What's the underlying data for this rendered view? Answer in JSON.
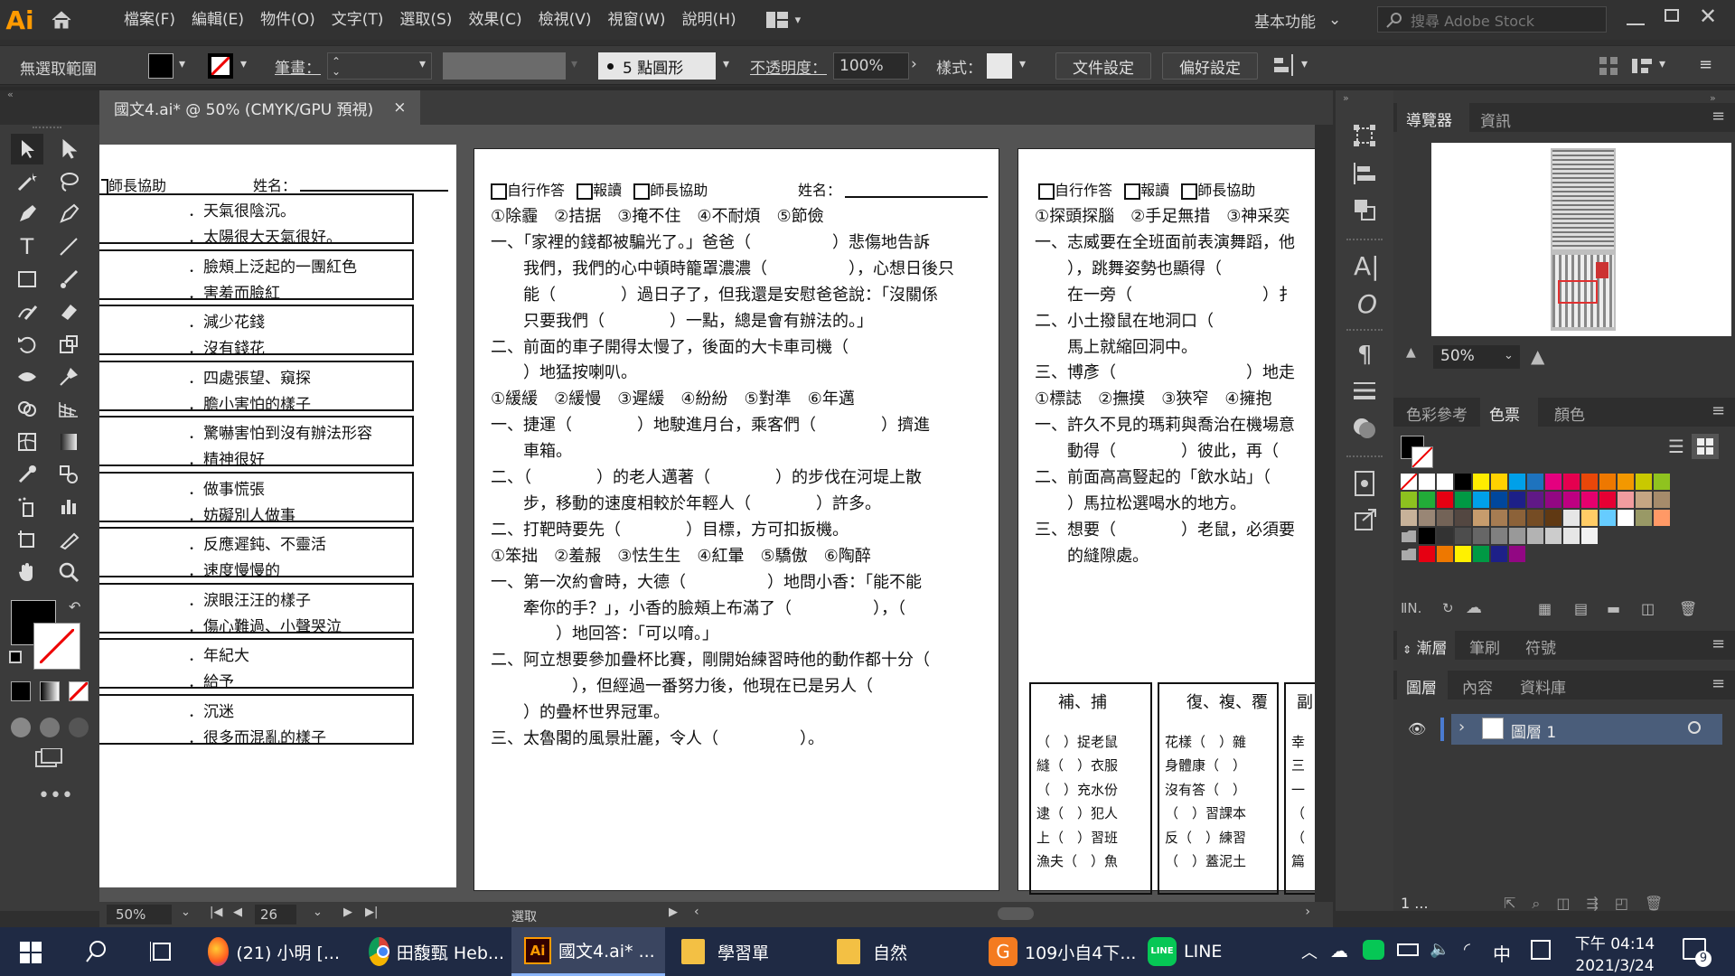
{
  "app": {
    "logo": "Ai"
  },
  "menu": [
    "檔案(F)",
    "編輯(E)",
    "物件(O)",
    "文字(T)",
    "選取(S)",
    "效果(C)",
    "檢視(V)",
    "視窗(W)",
    "說明(H)"
  ],
  "workspace": "基本功能",
  "stock_search": {
    "placeholder": "搜尋 Adobe Stock"
  },
  "control": {
    "selection": "無選取範圍",
    "stroke_label": "筆畫：",
    "brush": "5 點圓形",
    "opacity_label": "不透明度：",
    "opacity": "100%",
    "style_label": "樣式：",
    "doc_setup": "文件設定",
    "prefs": "偏好設定"
  },
  "doc_tab": {
    "title": "國文4.ai* @ 50% (CMYK/GPU 預視)",
    "close": "×"
  },
  "page1": {
    "header_help": "師長協助",
    "header_name": "姓名：",
    "boxes": [
      [
        "．天氣很陰沉。",
        "．太陽很大天氣很好。"
      ],
      [
        "．臉頰上泛起的一團紅色",
        "．害羞而臉紅"
      ],
      [
        "．減少花錢",
        "．沒有錢花"
      ],
      [
        "．四處張望、窺探",
        "．膽小害怕的樣子"
      ],
      [
        "．驚嚇害怕到沒有辦法形容",
        "．精神很好"
      ],
      [
        "．做事慌張",
        "．妨礙別人做事"
      ],
      [
        "．反應遲鈍、不靈活",
        "．速度慢慢的"
      ],
      [
        "．淚眼汪汪的樣子",
        "．傷心難過、小聲哭泣"
      ],
      [
        "．年紀大",
        "．給予"
      ],
      [
        "．沉迷",
        "．很多而混亂的樣子"
      ]
    ]
  },
  "page2": {
    "header": [
      "自行作答",
      "報讀",
      "師長協助"
    ],
    "name": "姓名：",
    "lines": [
      "①除霾　②拮据　③掩不住　④不耐煩　⑤節儉",
      "一、「家裡的錢都被騙光了。」爸爸（　　　　　）悲傷地告訴",
      "　　我們，我們的心中頓時籠罩濃濃（　　　　　），心想日後只",
      "　　能（　　　　）過日子了，但我還是安慰爸爸說：「沒關係",
      "　　只要我們（　　　　）一點，總是會有辦法的。」",
      "二、前面的車子開得太慢了，後面的大卡車司機（",
      "　　）地猛按喇叭。",
      "①緩緩　②緩慢　③遲緩　④紛紛　⑤對準　⑥年邁",
      "一、捷運（　　　　）地駛進月台，乘客們（　　　　）擠進",
      "　　車箱。",
      "二、（　　　　）的老人邁著（　　　　）的步伐在河堤上散",
      "　　步，移動的速度相較於年輕人（　　　　）許多。",
      "二、打靶時要先（　　　　）目標，方可扣扳機。",
      "①笨拙　②羞赧　③怯生生　④紅暈　⑤驕傲　⑥陶醉",
      "一、第一次約會時，大德（　　　　　）地問小香：「能不能",
      "　　牽你的手？」，小香的臉頰上布滿了（　　　　　），（",
      "　　　　）地回答：「可以唷。」",
      "二、阿立想要參加疊杯比賽，剛開始練習時他的動作都十分（",
      "　　　　　），但經過一番努力後，他現在已是另人（",
      "　　）的疊杯世界冠軍。",
      "三、太魯閣的風景壯麗，令人（　　　　　）。"
    ]
  },
  "page3": {
    "header": [
      "自行作答",
      "報讀",
      "師長協助"
    ],
    "lines": [
      "①探頭探腦　②手足無措　③神采奕",
      "一、志威要在全班面前表演舞蹈，他",
      "　　），跳舞姿勢也顯得（",
      "　　在一旁（　　　　　　　　）扌",
      "二、小土撥鼠在地洞口（",
      "　　馬上就縮回洞中。",
      "三、博彥（　　　　　　　　）地走",
      "①標誌　②撫摸　③狹窄　④擁抱",
      "一、許久不見的瑪莉與喬治在機場意",
      "　　動得（　　　　）彼此，再（",
      "二、前面高高豎起的「飲水站」（",
      "　　）馬拉松選喝水的地方。",
      "三、想要（　　　　）老鼠，必須要",
      "　　的縫隙處。"
    ],
    "box1": [
      "補、捕",
      "（　）捉老鼠",
      "縫（　）衣服",
      "（　）充水份",
      "逮（　）犯人",
      "上（　）習班",
      "漁夫（　）魚"
    ],
    "box2": [
      "復、複、覆",
      "花樣（　）雜",
      "身體康（　）",
      "沒有答（　）",
      "（　）習課本",
      "反（　）練習",
      "（　）蓋泥土"
    ],
    "box3": [
      "副",
      "幸",
      "三",
      "一",
      "（",
      "（",
      "篇"
    ]
  },
  "navigator": {
    "tabs": [
      "導覽器",
      "資訊"
    ],
    "zoom": "50%"
  },
  "swatch_panel": {
    "tabs": [
      "色彩參考",
      "色票",
      "顏色"
    ]
  },
  "layer_panel": {
    "top_tabs": [
      "漸層",
      "筆刷",
      "符號"
    ],
    "tabs": [
      "圖層",
      "內容",
      "資料庫"
    ],
    "layer_name": "圖層 1",
    "count": "1 ..."
  },
  "status": {
    "zoom": "50%",
    "artboard": "26",
    "mode": "選取"
  },
  "taskbar": {
    "apps": [
      "(21) 小明 [...",
      "田馥甄 Heb...",
      "國文4.ai* ...",
      "學習單",
      "自然",
      "109小自4下...",
      "LINE"
    ],
    "ime": "中",
    "time": "下午 04:14",
    "date": "2021/3/24",
    "notifications": "9"
  },
  "colors": {
    "accent": "#ff9a00",
    "taskbar": "#1f2a44",
    "active_layer": "#4a5d7a"
  }
}
